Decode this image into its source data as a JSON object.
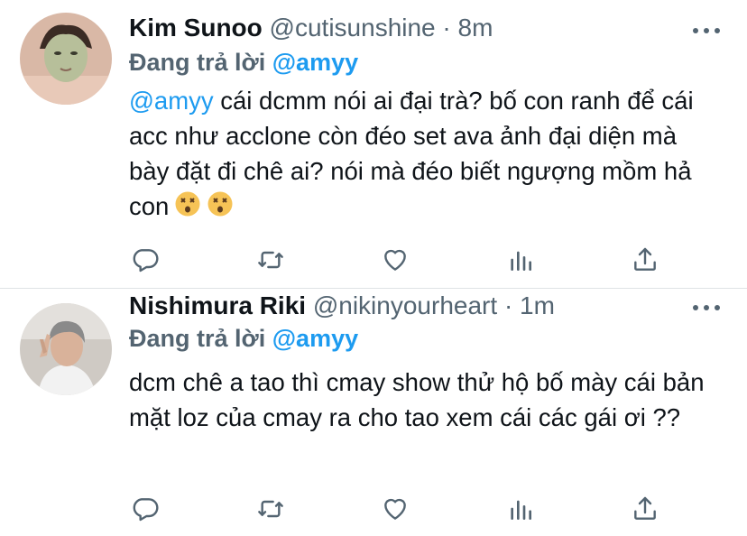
{
  "tweets": [
    {
      "name": "Kim Sunoo",
      "handle": "@cutisunshine",
      "separator": "·",
      "time": "8m",
      "replying_prefix": "Đang trả lời",
      "replying_to": "@amyy",
      "body_mention": "@amyy",
      "body_text": " cái dcmm nói ai đại trà? bố con ranh để cái acc như acclone còn đéo set ava ảnh đại diện mà bày đặt đi chê ai? nói mà đéo biết ngượng mồm hả con",
      "emojis": [
        "dizzy-face-emoji",
        "dizzy-face-emoji"
      ]
    },
    {
      "name": "Nishimura Riki",
      "handle": "@nikinyourheart",
      "separator": "·",
      "time": "1m",
      "replying_prefix": "Đang trả lời",
      "replying_to": "@amyy",
      "body_text": "dcm chê a tao thì cmay show thử hộ bố mày cái bản mặt loz của cmay ra cho tao xem cái các gái ơi ??"
    }
  ],
  "colors": {
    "link": "#1d9bf0",
    "secondary_text": "#536471",
    "divider": "#dfe3e6"
  },
  "icons": [
    "reply-icon",
    "retweet-icon",
    "like-icon",
    "analytics-icon",
    "share-icon",
    "more-icon"
  ]
}
